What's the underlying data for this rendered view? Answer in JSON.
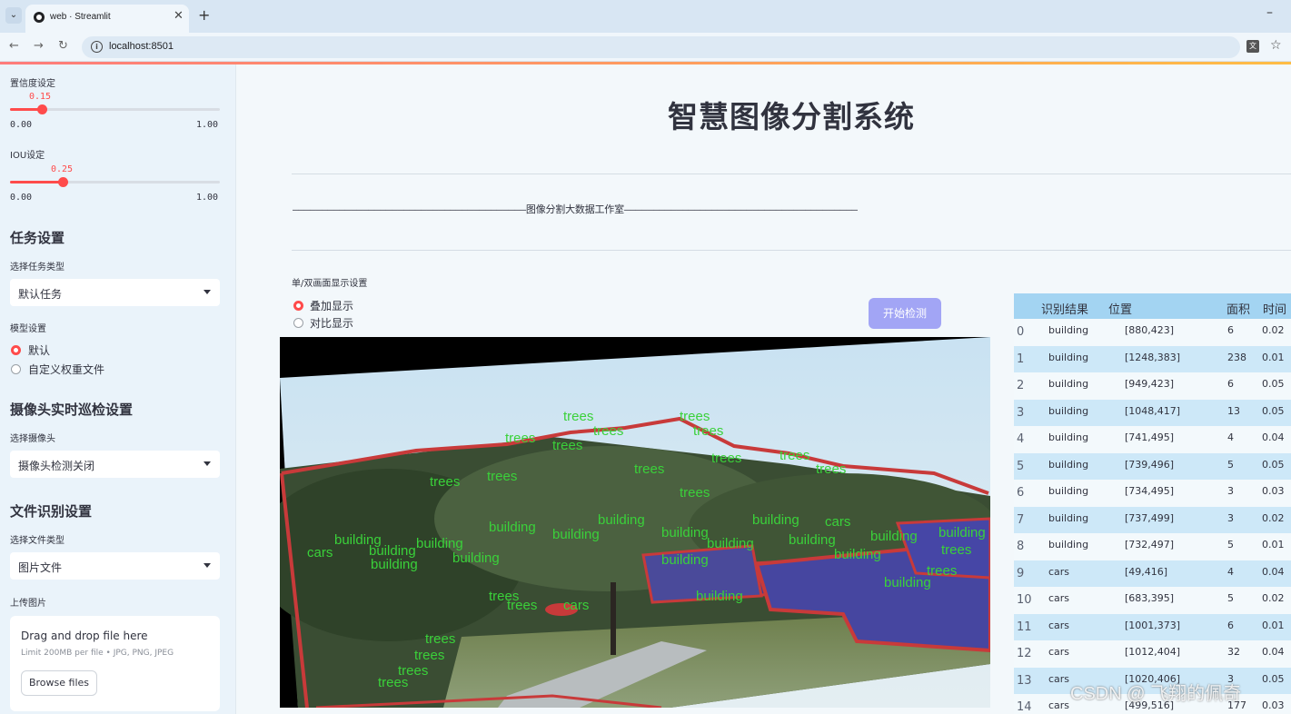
{
  "browser": {
    "tab_title": "web · Streamlit",
    "url": "localhost:8501"
  },
  "sidebar": {
    "confidence": {
      "label": "置信度设定",
      "value": "0.15",
      "min": "0.00",
      "max": "1.00",
      "fraction": 0.15
    },
    "iou": {
      "label": "IOU设定",
      "value": "0.25",
      "min": "0.00",
      "max": "1.00",
      "fraction": 0.25
    },
    "task_heading": "任务设置",
    "task_type_label": "选择任务类型",
    "task_type_value": "默认任务",
    "model_label": "模型设置",
    "model_options": [
      "默认",
      "自定义权重文件"
    ],
    "model_selected": 0,
    "camera_heading": "摄像头实时巡检设置",
    "camera_label": "选择摄像头",
    "camera_value": "摄像头检测关闭",
    "file_heading": "文件识别设置",
    "file_type_label": "选择文件类型",
    "file_type_value": "图片文件",
    "upload_label": "上传图片",
    "dropzone_title": "Drag and drop file here",
    "dropzone_limit": "Limit 200MB per file • JPG, PNG, JPEG",
    "browse_label": "Browse files"
  },
  "main": {
    "title": "智慧图像分割系统",
    "divider_text": "————————————————————————————————————————图像分割大数据工作室————————————————————————————————————————",
    "display_mode_label": "单/双画面显示设置",
    "display_options": [
      "叠加显示",
      "对比显示"
    ],
    "display_selected": 0,
    "detect_button": "开始检测"
  },
  "results_table": {
    "columns": [
      "识别结果",
      "位置",
      "面积",
      "时间"
    ],
    "rows": [
      {
        "idx": "0",
        "cls": "building",
        "pos": "[880,423]",
        "area": "6",
        "time": "0.02"
      },
      {
        "idx": "1",
        "cls": "building",
        "pos": "[1248,383]",
        "area": "238",
        "time": "0.01"
      },
      {
        "idx": "2",
        "cls": "building",
        "pos": "[949,423]",
        "area": "6",
        "time": "0.05"
      },
      {
        "idx": "3",
        "cls": "building",
        "pos": "[1048,417]",
        "area": "13",
        "time": "0.05"
      },
      {
        "idx": "4",
        "cls": "building",
        "pos": "[741,495]",
        "area": "4",
        "time": "0.04"
      },
      {
        "idx": "5",
        "cls": "building",
        "pos": "[739,496]",
        "area": "5",
        "time": "0.05"
      },
      {
        "idx": "6",
        "cls": "building",
        "pos": "[734,495]",
        "area": "3",
        "time": "0.03"
      },
      {
        "idx": "7",
        "cls": "building",
        "pos": "[737,499]",
        "area": "3",
        "time": "0.02"
      },
      {
        "idx": "8",
        "cls": "building",
        "pos": "[732,497]",
        "area": "5",
        "time": "0.01"
      },
      {
        "idx": "9",
        "cls": "cars",
        "pos": "[49,416]",
        "area": "4",
        "time": "0.04"
      },
      {
        "idx": "10",
        "cls": "cars",
        "pos": "[683,395]",
        "area": "5",
        "time": "0.02"
      },
      {
        "idx": "11",
        "cls": "cars",
        "pos": "[1001,373]",
        "area": "6",
        "time": "0.01"
      },
      {
        "idx": "12",
        "cls": "cars",
        "pos": "[1012,404]",
        "area": "32",
        "time": "0.04"
      },
      {
        "idx": "13",
        "cls": "cars",
        "pos": "[1020,406]",
        "area": "3",
        "time": "0.05"
      },
      {
        "idx": "14",
        "cls": "cars",
        "pos": "[499,516]",
        "area": "177",
        "time": "0.03"
      }
    ]
  },
  "image_labels": [
    "trees",
    "building",
    "cars"
  ],
  "watermark": "CSDN @ 飞翔的佩奇",
  "colors": {
    "accent": "#ff4b4b",
    "button": "#a2a5f5",
    "table_header": "#a3d4f2",
    "table_alt": "#cde8f8",
    "mask_outline": "#c83a3a",
    "label_green": "#3ad13a"
  }
}
